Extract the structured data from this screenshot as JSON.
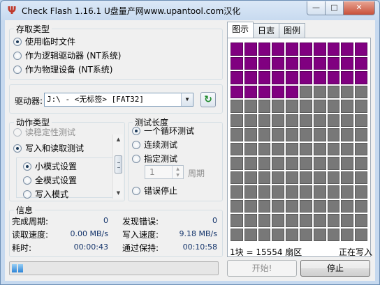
{
  "window": {
    "title": "Check Flash 1.16.1 U盘量产网www.upantool.com汉化",
    "icon": "usb-icon",
    "buttons": {
      "minimize": "—",
      "maximize": "□",
      "close": "✕"
    }
  },
  "access_type": {
    "legend": "存取类型",
    "options": [
      {
        "label": "使用临时文件",
        "selected": true
      },
      {
        "label": "作为逻辑驱动器 (NT系统)",
        "selected": false
      },
      {
        "label": "作为物理设备 (NT系统)",
        "selected": false
      }
    ]
  },
  "drive": {
    "label": "驱动器:",
    "value": "J:\\ - <无标签> [FAT32]",
    "refresh_icon": "refresh-icon"
  },
  "action_type": {
    "legend": "动作类型",
    "options": [
      {
        "label": "读稳定性测试",
        "selected": false,
        "enabled": false
      },
      {
        "label": "写入和读取测试",
        "selected": true,
        "enabled": true
      }
    ],
    "modes": [
      {
        "label": "小模式设置",
        "selected": true
      },
      {
        "label": "全模式设置",
        "selected": false
      },
      {
        "label": "写入模式",
        "selected": false
      }
    ]
  },
  "test_length": {
    "legend": "测试长度",
    "options": [
      {
        "label": "一个循环测试",
        "selected": true
      },
      {
        "label": "连续测试",
        "selected": false
      },
      {
        "label": "指定测试",
        "selected": false
      }
    ],
    "cycles_value": "1",
    "cycles_label": "周期",
    "stop_on_error": "错误停止"
  },
  "info": {
    "legend": "信息",
    "rows": [
      {
        "label": "完成周期:",
        "value": "0",
        "label2": "发现错误:",
        "value2": "0"
      },
      {
        "label": "读取速度:",
        "value": "0.00 MB/s",
        "label2": "写入速度:",
        "value2": "9.18 MB/s"
      },
      {
        "label": "耗时:",
        "value": "00:00:43",
        "label2": "通过保持:",
        "value2": "00:10:58"
      }
    ]
  },
  "progress": {
    "blocks": 2
  },
  "tabs": [
    {
      "label": "图示",
      "active": true
    },
    {
      "label": "日志",
      "active": false
    },
    {
      "label": "图例",
      "active": false
    }
  ],
  "block_map": {
    "columns": 10,
    "rows": 14,
    "written_blocks": 35,
    "colors": {
      "written": "#800080",
      "pending": "#787878"
    }
  },
  "status": {
    "block_size": "1块 = 15554 扇区",
    "state": "正在写入"
  },
  "buttons": {
    "start": "开始!",
    "stop": "停止"
  }
}
